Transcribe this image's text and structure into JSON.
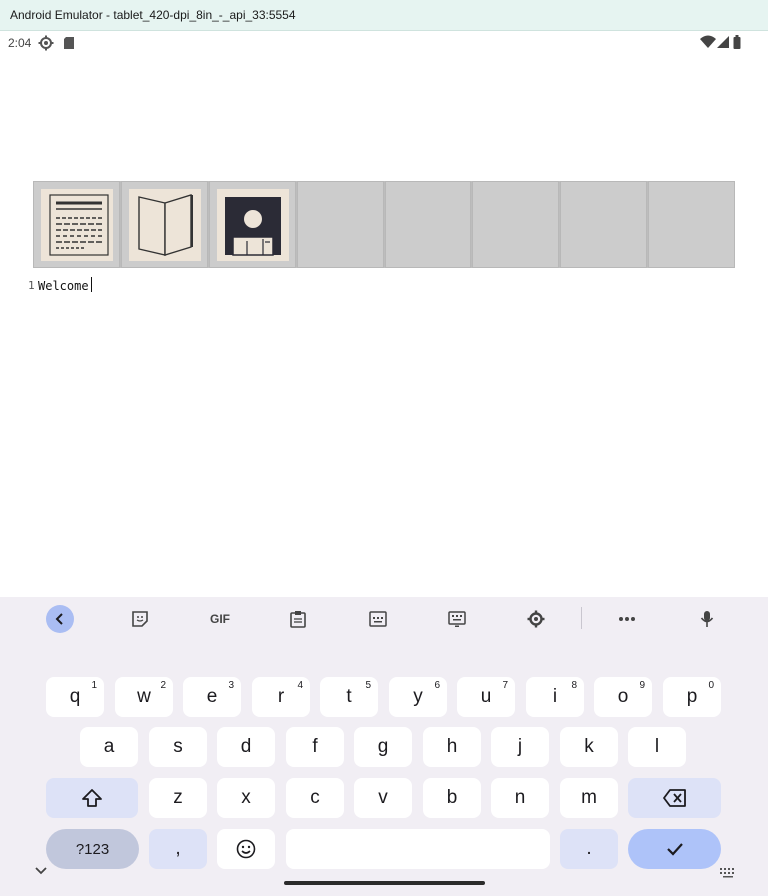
{
  "window": {
    "title": "Android Emulator - tablet_420-dpi_8in_-_api_33:5554"
  },
  "status_bar": {
    "time": "2:04"
  },
  "toolbar": {
    "buttons": [
      {
        "icon": "document-lines-icon"
      },
      {
        "icon": "open-book-icon"
      },
      {
        "icon": "floppy-disk-save-icon"
      },
      {
        "icon": "empty"
      },
      {
        "icon": "empty"
      },
      {
        "icon": "empty"
      },
      {
        "icon": "empty"
      },
      {
        "icon": "empty"
      }
    ]
  },
  "editor": {
    "line_number": "1",
    "line_text": "Welcome"
  },
  "keyboard": {
    "toolbar": [
      "back-icon",
      "sticker-icon",
      "gif-icon",
      "clipboard-icon",
      "floating-keyboard-icon",
      "keyboard-icon",
      "gear-icon",
      "more-icon",
      "mic-icon"
    ],
    "gif_label": "GIF",
    "row1": [
      {
        "label": "q",
        "hint": "1"
      },
      {
        "label": "w",
        "hint": "2"
      },
      {
        "label": "e",
        "hint": "3"
      },
      {
        "label": "r",
        "hint": "4"
      },
      {
        "label": "t",
        "hint": "5"
      },
      {
        "label": "y",
        "hint": "6"
      },
      {
        "label": "u",
        "hint": "7"
      },
      {
        "label": "i",
        "hint": "8"
      },
      {
        "label": "o",
        "hint": "9"
      },
      {
        "label": "p",
        "hint": "0"
      }
    ],
    "row2": [
      "a",
      "s",
      "d",
      "f",
      "g",
      "h",
      "j",
      "k",
      "l"
    ],
    "row3": [
      "z",
      "x",
      "c",
      "v",
      "b",
      "n",
      "m"
    ],
    "sym_label": "?123",
    "comma_label": ",",
    "period_label": "."
  },
  "colors": {
    "accent": "#aec3f9",
    "keyboard_bg": "#f1eef4",
    "titlebar_bg": "#e6f4f1"
  }
}
